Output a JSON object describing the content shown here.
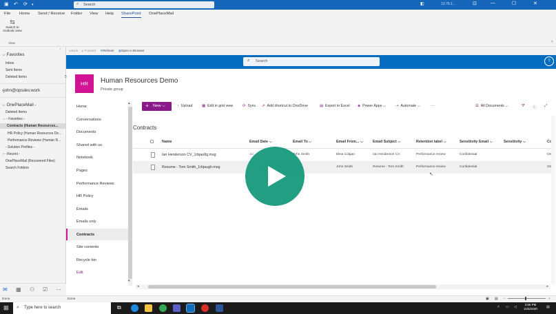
{
  "titlebar": {
    "search_placeholder": "Search",
    "truncated_title": "13:75:1..."
  },
  "menubar": {
    "items": [
      "File",
      "Home",
      "Send / Receive",
      "Folder",
      "View",
      "Help",
      "SharePoint",
      "OnePlaceMail"
    ],
    "active": "SharePoint"
  },
  "ribbon": {
    "switch_label_1": "Switch to",
    "switch_label_2": "Outlook view",
    "group_label": "View"
  },
  "browserbar": {
    "back": "Back",
    "forward": "Forward",
    "refresh": "Refresh",
    "open_in_browser": "Open in Browser"
  },
  "folderpane": {
    "favorites_header": "Favorites",
    "favorites": [
      {
        "label": "Inbox"
      },
      {
        "label": "Sent Items"
      },
      {
        "label": "Deleted Items",
        "count": "5"
      }
    ],
    "account": "john@opsdev.work",
    "oneplacemail_header": "OnePlaceMail -",
    "oneplacemail_items": [
      "Deleted Items",
      "- Favorites -",
      "Contracts (Human Resources...",
      "HR Policy (Human Resources De...",
      "Performance Reviews (Human R...",
      "- Solution Profiles -",
      "- Recent -",
      "OnePlaceMail (Recovered Files)",
      "Search Folders"
    ]
  },
  "sharepoint": {
    "search_placeholder": "Search",
    "help_icon_label": "?",
    "site": {
      "logo_text": "HR",
      "title": "Human Resources Demo",
      "subtitle": "Private group"
    },
    "nav": [
      "Home",
      "Conversations",
      "Documents",
      "Shared with us",
      "Notebook",
      "Pages",
      "Performance Reviews",
      "HR Policy",
      "Emails",
      "Emails only",
      "Contracts",
      "Site contents",
      "Recycle bin",
      "Edit"
    ],
    "nav_active": "Contracts",
    "commands": {
      "new": "New",
      "upload": "Upload",
      "edit_grid": "Edit in grid view",
      "sync": "Sync",
      "add_shortcut": "Add shortcut to OneDrive",
      "export_excel": "Export to Excel",
      "power_apps": "Power Apps",
      "automate": "Automate",
      "more": "···",
      "view": "All Documents"
    },
    "list_title": "Contracts",
    "columns": [
      "Name",
      "Email Date",
      "Email To",
      "Email From...",
      "Email Subject",
      "Retention label",
      "Sensitivity Email",
      "Sensitivity",
      "Co"
    ],
    "rows": [
      {
        "name": "Ian Henderson CV_1rbjao8g.msg",
        "email_date": "11/...",
        "email_to": "John Smith",
        "email_from": "Elisa Colgan",
        "subject": "Ian Henderson CV",
        "retention": "Performance review",
        "sensitivity_email": "Confidential",
        "sensitivity": "",
        "co": "On"
      },
      {
        "name": "Resume - Tom Smith_1rbjaugh.msg",
        "email_date": "",
        "email_to": "...ith",
        "email_from": "John Smith",
        "subject": "Resume - Tom Smith",
        "retention": "Performance review",
        "sensitivity_email": "Confidential",
        "sensitivity": "",
        "co": "On"
      }
    ]
  },
  "statusbar": {
    "left": "Done",
    "inner": "Done"
  },
  "taskbar": {
    "search_placeholder": "Type here to search",
    "time": "3:56 PM",
    "date": "11/5/2020"
  },
  "colors": {
    "outlook_blue": "#1565b8",
    "sharepoint_header": "#046cc1",
    "site_accent": "#d11394",
    "command_purple": "#8a1a8a",
    "play_button": "#1b9c7e"
  }
}
